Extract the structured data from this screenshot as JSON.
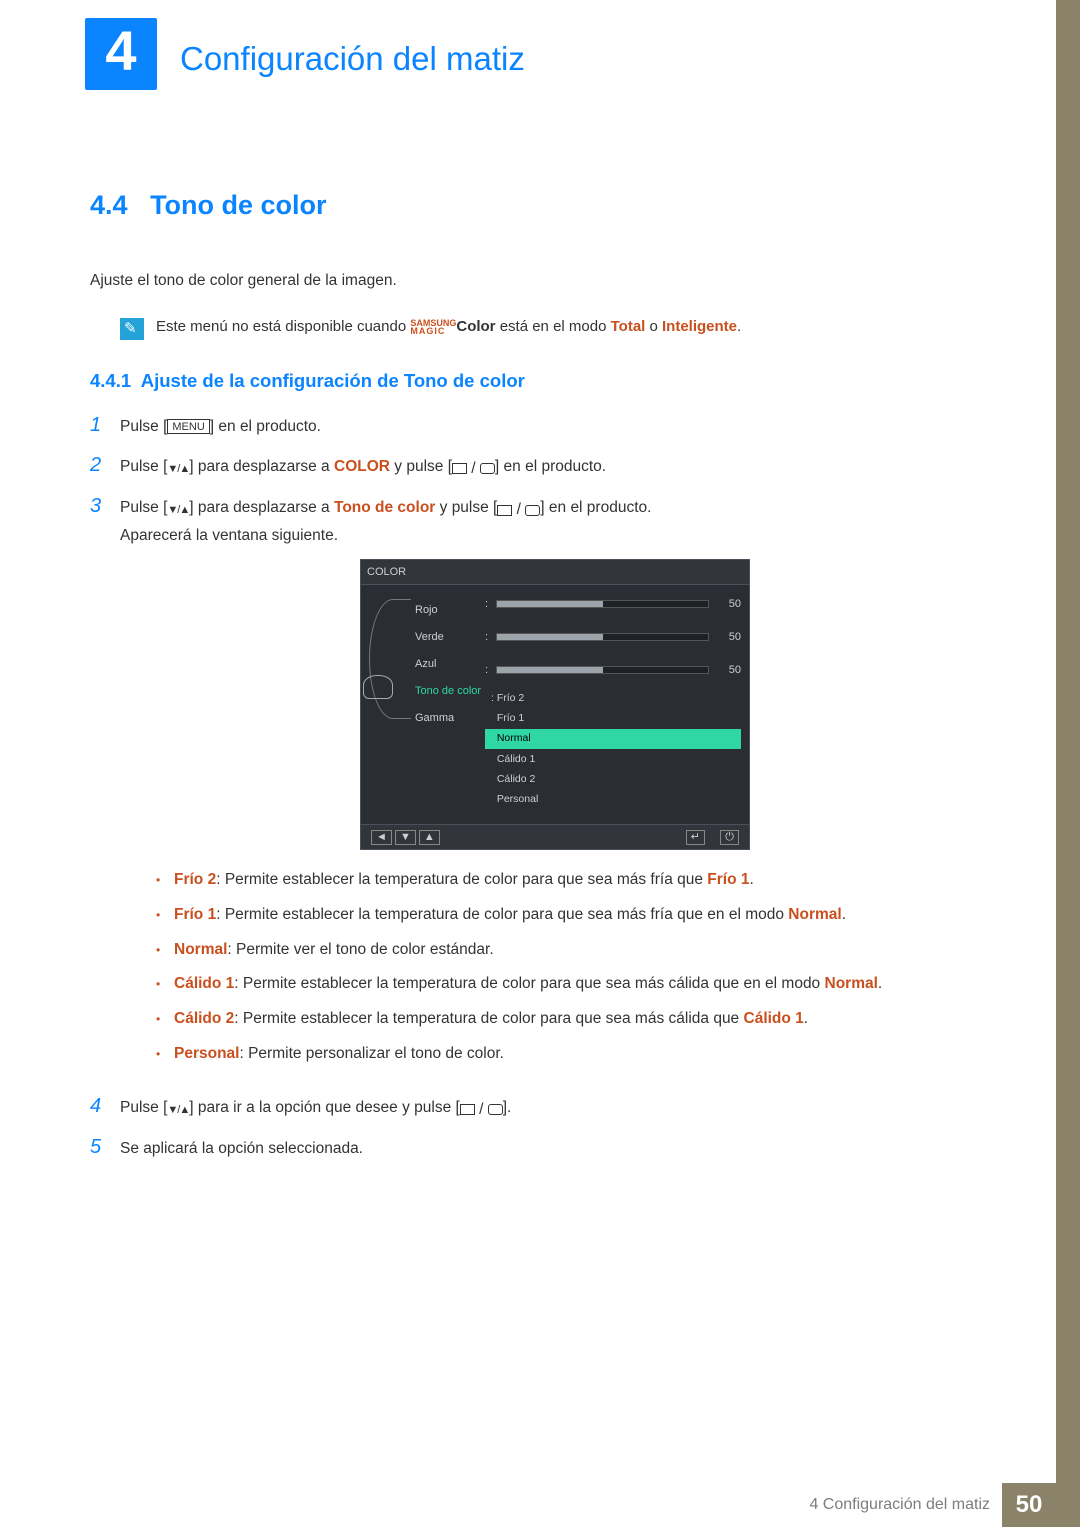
{
  "chapter": {
    "number": "4",
    "title": "Configuración del matiz"
  },
  "section": {
    "number": "4.4",
    "title": "Tono de color"
  },
  "intro": "Ajuste el tono de color general de la imagen.",
  "note": {
    "pre": "Este menú no está disponible cuando ",
    "magic_top": "SAMSUNG",
    "magic_bottom": "MAGIC",
    "color_word": "Color",
    "mid": " está en el modo ",
    "total": "Total",
    "or": " o ",
    "intel": "Inteligente",
    "end": "."
  },
  "subsection": {
    "number": "4.4.1",
    "title": "Ajuste de la configuración de Tono de color"
  },
  "steps": {
    "s1": {
      "pre": "Pulse [",
      "menu": "MENU",
      "post": "] en el producto."
    },
    "s2": {
      "pre": "Pulse [",
      "mid1": "] para desplazarse a ",
      "color": "COLOR",
      "mid2": " y pulse [",
      "post": "] en el producto."
    },
    "s3": {
      "pre": "Pulse [",
      "mid1": "] para desplazarse a ",
      "tdc": "Tono de color",
      "mid2": " y pulse [",
      "post": "] en el producto.",
      "after": "Aparecerá la ventana siguiente."
    },
    "s4": {
      "pre": "Pulse [",
      "mid": "] para ir a la opción que desee y pulse [",
      "post": "]."
    },
    "s5": "Se aplicará la opción seleccionada."
  },
  "osd": {
    "title": "COLOR",
    "labels": {
      "rojo": "Rojo",
      "verde": "Verde",
      "azul": "Azul",
      "tono": "Tono de color",
      "gamma": "Gamma"
    },
    "vals": {
      "rojo": "50",
      "verde": "50",
      "azul": "50"
    },
    "dd": [
      "Frío 2",
      "Frío 1",
      "Normal",
      "Cálido 1",
      "Cálido 2",
      "Personal"
    ],
    "footer": {
      "back": "◄",
      "down": "▼",
      "up": "▲",
      "enter": "↵",
      "power": "⏻"
    }
  },
  "bullets": {
    "b1": {
      "k": "Frío 2",
      "t": ": Permite establecer la temperatura de color para que sea más fría que ",
      "ref": "Frío 1",
      "end": "."
    },
    "b2": {
      "k": "Frío 1",
      "t": ": Permite establecer la temperatura de color para que sea más fría que en el modo ",
      "ref": "Normal",
      "end": "."
    },
    "b3": {
      "k": "Normal",
      "t": ": Permite ver el tono de color estándar."
    },
    "b4": {
      "k": "Cálido 1",
      "t": ": Permite establecer la temperatura de color para que sea más cálida que en el modo ",
      "ref": "Normal",
      "end": "."
    },
    "b5": {
      "k": "Cálido 2",
      "t": ": Permite establecer la temperatura de color para que sea más cálida que ",
      "ref": "Cálido 1",
      "end": "."
    },
    "b6": {
      "k": "Personal",
      "t": ": Permite personalizar el tono de color."
    }
  },
  "footer": {
    "text": "4 Configuración del matiz",
    "page": "50"
  }
}
